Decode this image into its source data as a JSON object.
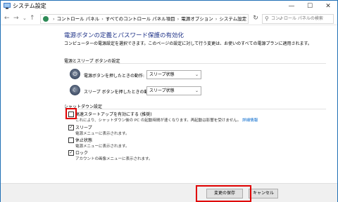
{
  "window": {
    "title": "システム設定",
    "controls": {
      "minimize": "—",
      "maximize": "☐",
      "close": "✕"
    }
  },
  "address_bar": {
    "back": "←",
    "forward": "→",
    "up_dropdown": "⌄",
    "up": "↑",
    "breadcrumbs": [
      "コントロール パネル",
      "すべてのコントロール パネル項目",
      "電源オプション",
      "システム設定"
    ],
    "separator": "›",
    "dropdown": "⌄",
    "refresh": "↻",
    "search_placeholder": "コントロール パネルの検索"
  },
  "page": {
    "heading": "電源ボタンの定義とパスワード保護の有効化",
    "description": "コンピューターの電源設定を選択できます。このページの設定に対して行う変更は、お使いのすべての電源プランに適用されます。",
    "section_power_buttons": "電源とスリープ ボタンの設定",
    "power_button_label": "電源ボタンを押したときの動作:",
    "power_button_value": "スリープ状態",
    "sleep_button_label": "スリープ ボタンを押したときの動作:",
    "sleep_button_value": "スリープ状態",
    "section_shutdown": "シャットダウン設定",
    "shutdown_options": [
      {
        "label": "高速スタートアップを有効にする (推奨)",
        "checked": false,
        "desc": "これにより、シャットダウン後の PC の起動時間が速くなります。再起動は影響を受けません。",
        "link": "詳細情報"
      },
      {
        "label": "スリープ",
        "checked": true,
        "desc": "電源メニューに表示されます。"
      },
      {
        "label": "休止状態",
        "checked": false,
        "desc": "電源メニューに表示されます。"
      },
      {
        "label": "ロック",
        "checked": true,
        "desc": "アカウントの画像メニューに表示されます。"
      }
    ]
  },
  "footer": {
    "save_label": "変更の保存",
    "cancel_label": "キャンセル"
  },
  "colors": {
    "heading": "#1e3287",
    "link": "#0066cc",
    "highlight": "#e00000"
  }
}
